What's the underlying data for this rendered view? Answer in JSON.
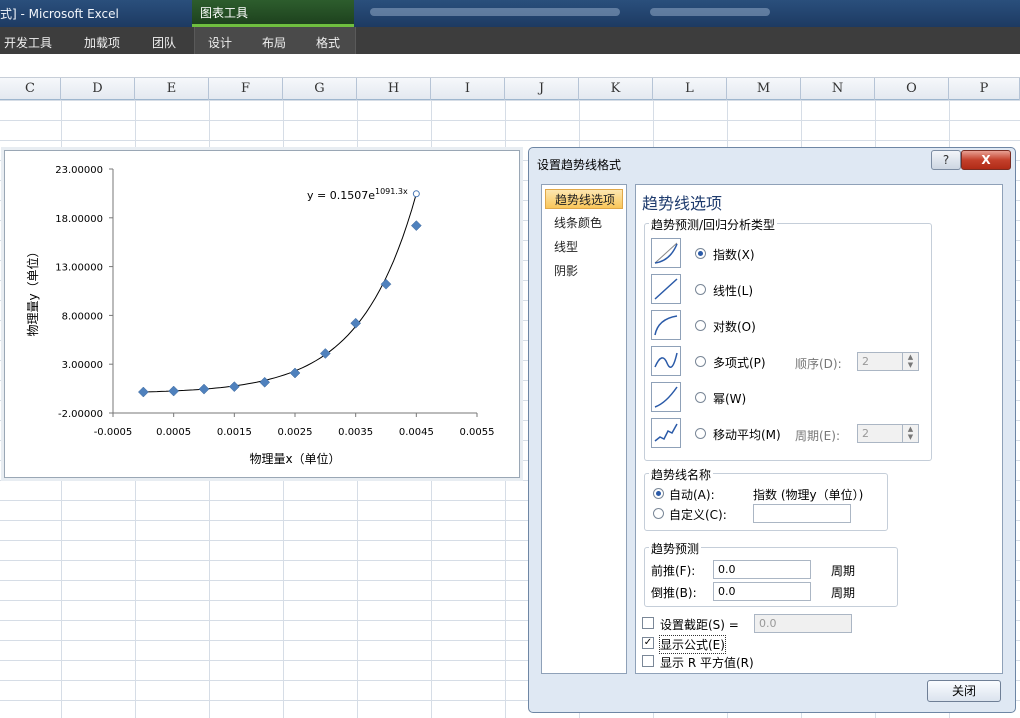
{
  "window": {
    "app_title": "式] - Microsoft Excel",
    "context_tab_group": "图表工具"
  },
  "ribbon": {
    "tabs": [
      "开发工具",
      "加载项",
      "团队",
      "设计",
      "布局",
      "格式"
    ]
  },
  "columns": [
    "C",
    "D",
    "E",
    "F",
    "G",
    "H",
    "I",
    "J",
    "K",
    "L",
    "M",
    "N",
    "O",
    "P"
  ],
  "chart": {
    "equation_main": "y = 0.1507e",
    "equation_exp": "1091.3x"
  },
  "chart_data": {
    "type": "scatter",
    "xlabel": "物理量x（单位）",
    "ylabel": "物理量y（单位）",
    "x_ticks": [
      "-0.0005",
      "0.0005",
      "0.0015",
      "0.0025",
      "0.0035",
      "0.0045",
      "0.0055"
    ],
    "y_ticks": [
      "-2.00000",
      "3.00000",
      "8.00000",
      "13.00000",
      "18.00000",
      "23.00000"
    ],
    "xlim": [
      -0.0005,
      0.0055
    ],
    "ylim": [
      -2,
      23
    ],
    "x": [
      0.0,
      0.0005,
      0.001,
      0.0015,
      0.002,
      0.0025,
      0.003,
      0.0035,
      0.004,
      0.0045
    ],
    "y": [
      0.15,
      0.25,
      0.45,
      0.7,
      1.15,
      2.1,
      4.1,
      7.2,
      11.2,
      17.2
    ],
    "trendline": {
      "type": "exponential",
      "a": 0.1507,
      "b": 1091.3
    },
    "grid": false
  },
  "dialog": {
    "title": "设置趋势线格式",
    "help": "?",
    "close_x": "X",
    "nav_items": [
      "趋势线选项",
      "线条颜色",
      "线型",
      "阴影"
    ],
    "heading": "趋势线选项",
    "type_group_title": "趋势预测/回归分析类型",
    "types": [
      {
        "label": "指数(X)",
        "selected": true
      },
      {
        "label": "线性(L)",
        "selected": false
      },
      {
        "label": "对数(O)",
        "selected": false
      },
      {
        "label": "多项式(P)",
        "selected": false,
        "extra_label": "顺序(D):",
        "extra_value": "2"
      },
      {
        "label": "幂(W)",
        "selected": false
      },
      {
        "label": "移动平均(M)",
        "selected": false,
        "extra_label": "周期(E):",
        "extra_value": "2"
      }
    ],
    "name_group_title": "趋势线名称",
    "auto_label": "自动(A):",
    "auto_value": "指数 (物理y（单位）)",
    "custom_label": "自定义(C):",
    "forecast_group_title": "趋势预测",
    "forward_label": "前推(F):",
    "forward_value": "0.0",
    "backward_label": "倒推(B):",
    "backward_value": "0.0",
    "period_unit": "周期",
    "intercept_label": "设置截距(S) =",
    "intercept_value": "0.0",
    "show_equation_label": "显示公式(E)",
    "show_r2_label": "显示 R 平方值(R)",
    "close_button": "关闭"
  }
}
